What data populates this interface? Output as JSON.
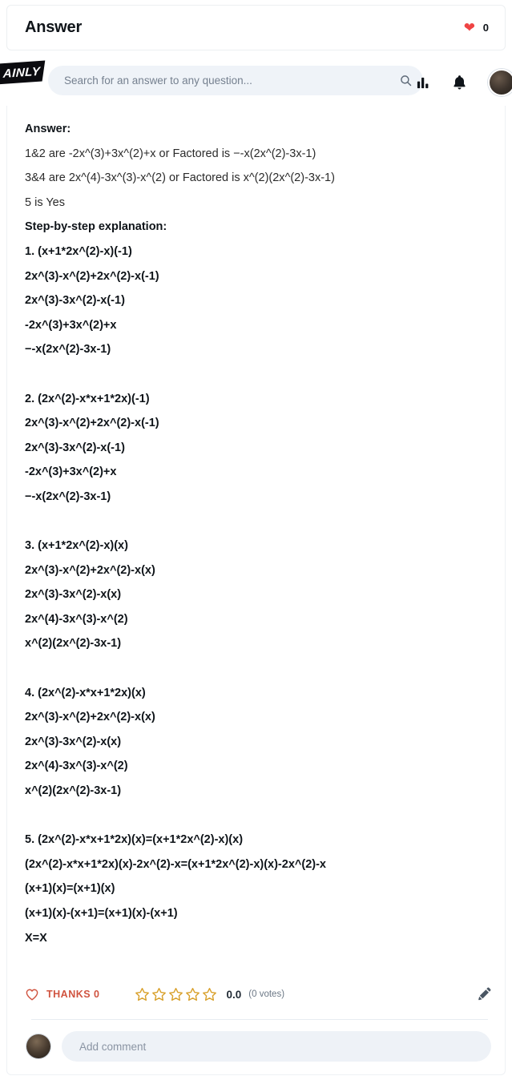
{
  "header": {
    "title": "Answer",
    "likes_count": "0",
    "heart_icon": "heart-filled-icon",
    "heart_color": "#ef4444"
  },
  "navbar": {
    "brand": "AINLY",
    "search": {
      "placeholder": "Search for an answer to any question...",
      "value": "",
      "icon": "search-icon"
    },
    "icons": [
      {
        "name": "stats-bar-chart-icon"
      },
      {
        "name": "notification-bell-icon"
      },
      {
        "name": "user-avatar-icon"
      }
    ]
  },
  "answer": {
    "heading": "Answer:",
    "summary": [
      "1&2 are -2x^(3)+3x^(2)+x or Factored is −-x(2x^(2)-3x-1)",
      "3&4 are 2x^(4)-3x^(3)-x^(2) or Factored is x^(2)(2x^(2)-3x-1)",
      "5 is Yes"
    ],
    "explanation_heading": "Step-by-step explanation:",
    "steps": [
      {
        "lines": [
          "1. (x+1*2x^(2)-x)(-1)",
          "2x^(3)-x^(2)+2x^(2)-x(-1)",
          "2x^(3)-3x^(2)-x(-1)",
          "-2x^(3)+3x^(2)+x",
          "−-x(2x^(2)-3x-1)"
        ]
      },
      {
        "lines": [
          "2. (2x^(2)-x*x+1*2x)(-1)",
          "2x^(3)-x^(2)+2x^(2)-x(-1)",
          "2x^(3)-3x^(2)-x(-1)",
          "-2x^(3)+3x^(2)+x",
          "−-x(2x^(2)-3x-1)"
        ]
      },
      {
        "lines": [
          "3. (x+1*2x^(2)-x)(x)",
          "2x^(3)-x^(2)+2x^(2)-x(x)",
          "2x^(3)-3x^(2)-x(x)",
          "2x^(4)-3x^(3)-x^(2)",
          "x^(2)(2x^(2)-3x-1)"
        ]
      },
      {
        "lines": [
          "4. (2x^(2)-x*x+1*2x)(x)",
          "2x^(3)-x^(2)+2x^(2)-x(x)",
          "2x^(3)-3x^(2)-x(x)",
          "2x^(4)-3x^(3)-x^(2)",
          "x^(2)(2x^(2)-3x-1)"
        ]
      },
      {
        "lines": [
          "5. (2x^(2)-x*x+1*2x)(x)=(x+1*2x^(2)-x)(x)",
          "(2x^(2)-x*x+1*2x)(x)-2x^(2)-x=(x+1*2x^(2)-x)(x)-2x^(2)-x",
          "(x+1)(x)=(x+1)(x)",
          "(x+1)(x)-(x+1)=(x+1)(x)-(x+1)",
          "X=X"
        ]
      }
    ]
  },
  "footer": {
    "thanks_label": "THANKS 0",
    "thanks_icon": "heart-outline-icon",
    "thanks_color": "#d0533f",
    "stars_filled": 0,
    "stars_total": 5,
    "star_color": "#d9a12c",
    "rating_value": "0.0",
    "votes_label": "(0 votes)",
    "edit_icon": "pencil-edit-icon"
  },
  "comment": {
    "avatar": "user-avatar-image",
    "placeholder": "Add comment",
    "value": ""
  }
}
